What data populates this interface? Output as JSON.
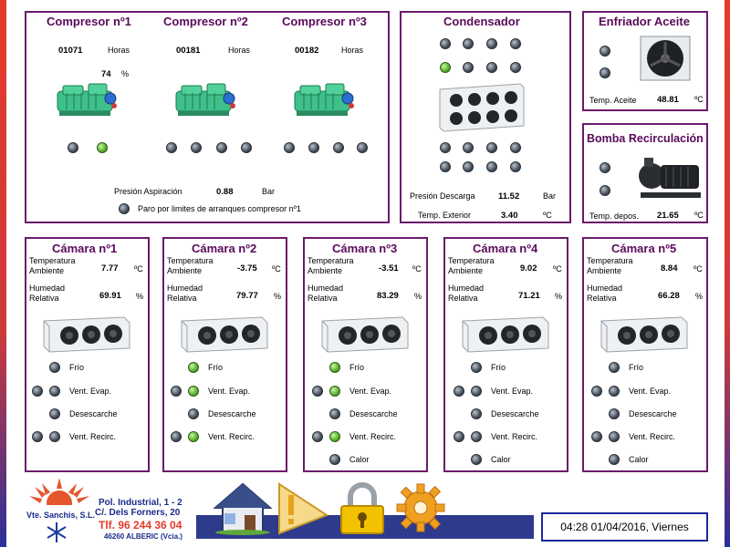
{
  "compressors": [
    {
      "title": "Compresor nº1",
      "hours": "01071",
      "hours_unit": "Horas",
      "load": "74",
      "load_unit": "%"
    },
    {
      "title": "Compresor nº2",
      "hours": "00181",
      "hours_unit": "Horas"
    },
    {
      "title": "Compresor nº3",
      "hours": "00182",
      "hours_unit": "Horas"
    }
  ],
  "compressor_panel": {
    "suction_label": "Presión Aspiración",
    "suction_value": "0.88",
    "suction_unit": "Bar",
    "alarm_label": "Paro por limites de arranques compresor nº1"
  },
  "condenser": {
    "title": "Condensador",
    "discharge_label": "Presión Descarga",
    "discharge_value": "11.52",
    "discharge_unit": "Bar",
    "ext_temp_label": "Temp. Exterior",
    "ext_temp_value": "3.40",
    "ext_temp_unit": "ºC"
  },
  "oil_cooler": {
    "title": "Enfriador Aceite",
    "temp_label": "Temp. Aceite",
    "temp_value": "48.81",
    "temp_unit": "ºC"
  },
  "pump": {
    "title": "Bomba Recirculación",
    "temp_label": "Temp. depos.",
    "temp_value": "21.65",
    "temp_unit": "ºC"
  },
  "chamber_labels": {
    "temp_line1": "Temperatura",
    "temp_line2": "Ambiente",
    "temp_unit": "ºC",
    "hum_line1": "Humedad",
    "hum_line2": "Relativa",
    "hum_unit": "%",
    "cold": "Frío",
    "evap_fans": "Vent. Evap.",
    "defrost": "Desescarche",
    "recirc_fans": "Vent. Recirc.",
    "heat": "Calor"
  },
  "chambers": [
    {
      "title": "Cámara nº1",
      "temp": "7.77",
      "humidity": "69.91"
    },
    {
      "title": "Cámara nº2",
      "temp": "-3.75",
      "humidity": "79.77"
    },
    {
      "title": "Cámara nº3",
      "temp": "-3.51",
      "humidity": "83.29"
    },
    {
      "title": "Cámara nº4",
      "temp": "9.02",
      "humidity": "71.21"
    },
    {
      "title": "Cámara nº5",
      "temp": "8.84",
      "humidity": "66.28"
    }
  ],
  "company": {
    "name": "Vte. Sanchis, S.L.",
    "addr1": "Pol. Industrial, 1 - 2",
    "addr2": "C/. Dels Forners, 20",
    "phone": "Tlf. 96 244 36 04",
    "city": "46260 ALBERIC (Vcia.)"
  },
  "nav": [
    "home-icon",
    "alarm-warning-icon",
    "lock-icon",
    "settings-gear-icon"
  ],
  "status": {
    "datetime": "04:28  01/04/2016, Viernes"
  },
  "colors": {
    "panel_border": "#6b1a6b",
    "title": "#5a0a5a",
    "led_on": "#5fb432",
    "led_off": "#46505a",
    "footer": "#2e3a8c"
  }
}
